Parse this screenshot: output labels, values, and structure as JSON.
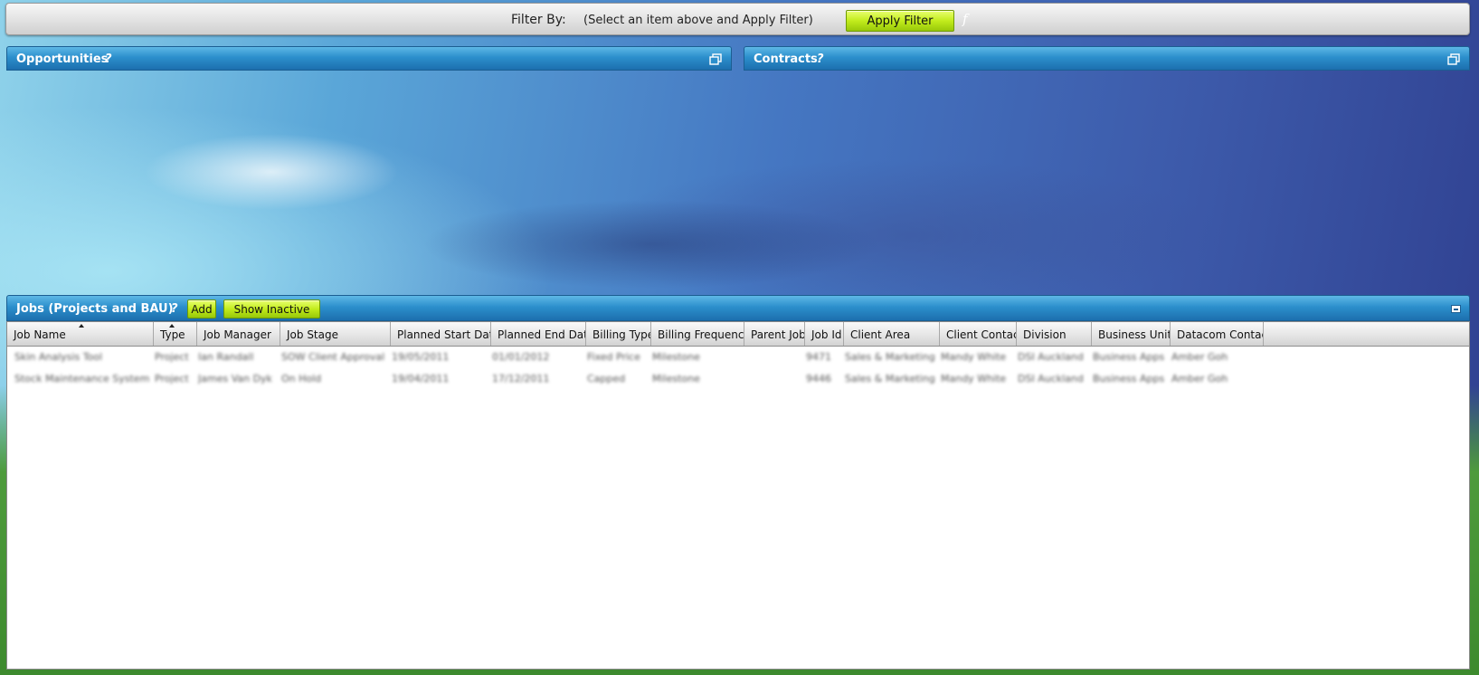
{
  "filter": {
    "label": "Filter By:",
    "hint": "(Select an item above and Apply Filter)",
    "apply_label": "Apply Filter",
    "f_glyph": "f"
  },
  "panels": {
    "opportunities": {
      "title": "Opportunities",
      "help": "?"
    },
    "contracts": {
      "title": "Contracts",
      "help": "?"
    }
  },
  "jobs": {
    "title": "Jobs (Projects and BAU)",
    "help": "?",
    "add_label": "Add",
    "show_inactive_label": "Show Inactive",
    "columns": [
      "Job Name",
      "Type",
      "Job Manager",
      "Job Stage",
      "Planned Start Date",
      "Planned End Date",
      "Billing Type",
      "Billing Frequency",
      "Parent Job",
      "Job Id",
      "Client Area",
      "Client Contact",
      "Division",
      "Business Unit",
      "Datacom Contact"
    ],
    "rows": [
      [
        "Skin Analysis Tool",
        "Project",
        "Ian Randall",
        "SOW Client Approval",
        "19/05/2011",
        "01/01/2012",
        "Fixed Price",
        "Milestone",
        "",
        "9471",
        "Sales & Marketing",
        "Mandy White",
        "DSI Auckland",
        "Business Apps",
        "Amber Goh"
      ],
      [
        "Stock Maintenance System",
        "Project",
        "James Van Dyk",
        "On Hold",
        "19/04/2011",
        "17/12/2011",
        "Capped",
        "Milestone",
        "",
        "9446",
        "Sales & Marketing",
        "Mandy White",
        "DSI Auckland",
        "Business Apps",
        "Amber Goh"
      ]
    ]
  },
  "icons": {
    "restore": "restore-window-icon",
    "minimize": "minimize-icon",
    "sort": "sort-ascending-icon"
  },
  "colors": {
    "header_blue": "#2c8fcc",
    "button_green": "#c2ec1c"
  }
}
